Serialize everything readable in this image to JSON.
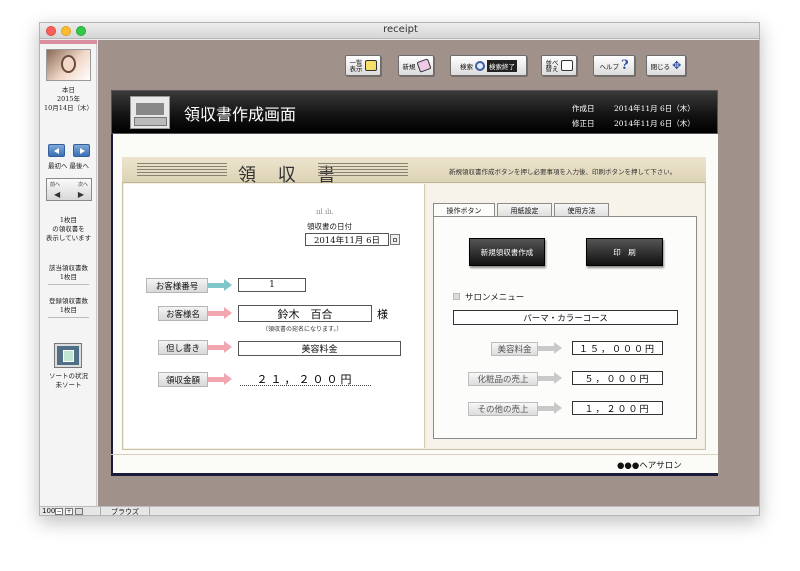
{
  "window": {
    "title": "receipt"
  },
  "sidebar": {
    "today_label": "本日",
    "year": "2015年",
    "date": "10月14日（木）",
    "first_label": "最初へ",
    "last_label": "最後へ",
    "nav_prev": "前へ",
    "nav_next": "次へ",
    "record_count": "1枚目",
    "record_line2": "の領収書を",
    "record_line3": "表示しています",
    "found_label": "該当領収書数",
    "found_value": "1枚目",
    "total_label": "登録領収書数",
    "total_value": "1枚目",
    "sort_label": "ソートの状況",
    "sort_value": "未ソート"
  },
  "statusbar": {
    "zoom": "100",
    "mode": "ブラウズ"
  },
  "toolbar": {
    "list_label": "一覧\n表示",
    "new_label": "新規",
    "search_label": "検索",
    "search_end_label": "検索終了",
    "sort_label": "並べ\n替え",
    "help_label": "ヘルプ",
    "close_label": "閉じる"
  },
  "header": {
    "title": "領収書作成画面",
    "created_label": "作成日",
    "created_value": "2014年11月 6日（木）",
    "modified_label": "修正日",
    "modified_value": "2014年11月 6日（木）"
  },
  "card": {
    "title": "領 収 書",
    "instruction": "新規領収書作成ボタンを押し必要事項を入力後、印刷ボタンを押して下さい。"
  },
  "form": {
    "date_label": "領収書の日付",
    "date_value": "2014年11月 6日",
    "customer_no_label": "お客様番号",
    "customer_no_value": "1",
    "customer_name_label": "お客様名",
    "customer_name_value": "鈴木　百合",
    "honorific": "様",
    "name_note": "（領収書の宛名になります。）",
    "memo_label": "但し書き",
    "memo_value": "美容料金",
    "amount_label": "領収金額",
    "amount_value": "２１，２００円"
  },
  "tabs": [
    {
      "label": "操作ボタン"
    },
    {
      "label": "用紙設定"
    },
    {
      "label": "使用方法"
    }
  ],
  "actions": {
    "new_receipt": "新規領収書作成",
    "print": "印　刷"
  },
  "salon_menu": {
    "label": "サロンメニュー",
    "value": "パーマ・カラーコース"
  },
  "sales": [
    {
      "label": "美容料金",
      "value": "１５，０００円"
    },
    {
      "label": "化粧品の売上",
      "value": "５，０００円"
    },
    {
      "label": "その他の売上",
      "value": "１，２００円"
    }
  ],
  "footer": {
    "salon_name": "●●●ヘアサロン"
  },
  "colors": {
    "teal_arrow": "#7fc6c9",
    "pink_arrow": "#f2a6b0",
    "gray_arrow": "#c9c9c9",
    "main_bg": "#a0928b"
  }
}
